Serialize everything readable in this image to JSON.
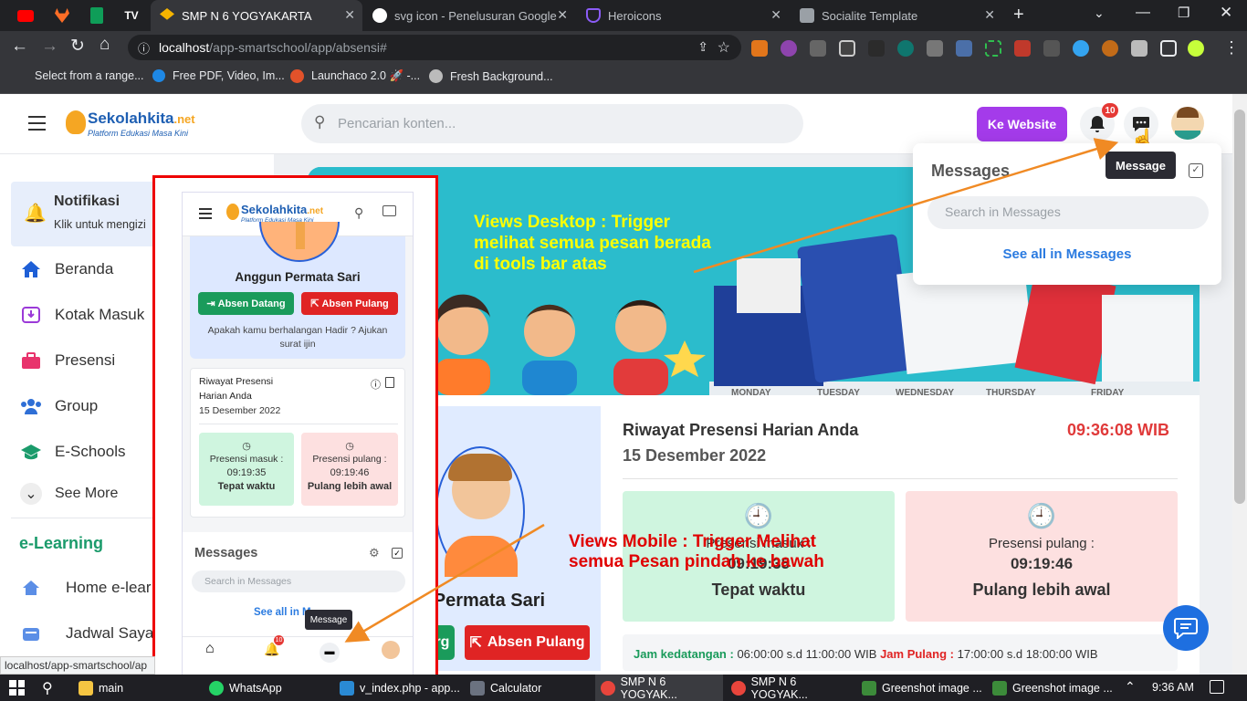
{
  "browser": {
    "tabs": [
      {
        "label": "SMP N 6 YOGYAKARTA"
      },
      {
        "label": "svg icon - Penelusuran Google"
      },
      {
        "label": "Heroicons"
      },
      {
        "label": "Socialite Template"
      }
    ],
    "url_host": "localhost",
    "url_path": "/app-smartschool/app/absensi#",
    "bookmarks": [
      "Select from a range...",
      "Free PDF, Video, Im...",
      "Launchaco 2.0 🚀 -...",
      "Fresh Background..."
    ]
  },
  "header": {
    "logo_text": "Sekolahkita",
    "logo_suffix": ".net",
    "logo_tagline": "Platform Edukasi Masa Kini",
    "search_placeholder": "Pencarian konten...",
    "website_button": "Ke Website",
    "notif_count": "10"
  },
  "sidebar": {
    "notif_title": "Notifikasi",
    "notif_sub": "Klik untuk mengizi",
    "items": [
      "Beranda",
      "Kotak Masuk",
      "Presensi",
      "Group",
      "E-Schools"
    ],
    "see_more": "See More",
    "section": "e-Learning",
    "learning_items": [
      "Home e-lear",
      "Jadwal Saya"
    ]
  },
  "messages_dropdown": {
    "title": "Messages",
    "tooltip": "Message",
    "search_placeholder": "Search in Messages",
    "see_all": "See all in Messages"
  },
  "annotations": {
    "desktop": "Views Desktop : Trigger melihat semua pesan berada di tools bar atas",
    "desktop_lines": [
      "Views Desktop : Trigger",
      "melihat semua pesan berada",
      "di tools bar atas"
    ],
    "mobile_lines": [
      "Views Mobile : Trigger Melihat",
      "semua Pesan pindah ke bawah"
    ]
  },
  "presence": {
    "title": "Riwayat Presensi Harian Anda",
    "date": "15 Desember 2022",
    "time": "09:36:08 WIB",
    "in_label": "Presensi masuk :",
    "in_time": "09:19:35",
    "in_status": "Tepat waktu",
    "out_label": "Presensi pulang :",
    "out_time": "09:19:46",
    "out_status": "Pulang lebih awal",
    "name_partial": "n Permata Sari",
    "btn_in_partial": "arg",
    "btn_out": "Absen Pulang",
    "schedule_in_label": "Jam kedatangan :",
    "schedule_in": "06:00:00 s.d 11:00:00 WIB",
    "schedule_out_label": "Jam Pulang :",
    "schedule_out": "17:00:00 s.d 18:00:00 WIB"
  },
  "mobile": {
    "name": "Anggun Permata Sari",
    "btn_in": "Absen Datang",
    "btn_out": "Absen Pulang",
    "absent_note": "Apakah kamu berhalangan Hadir ? Ajukan surat ijin",
    "history_title_1": "Riwayat Presensi",
    "history_title_2": "Harian Anda",
    "date": "15 Desember 2022",
    "in_label": "Presensi masuk :",
    "in_time": "09:19:35",
    "in_status": "Tepat waktu",
    "out_label": "Presensi pulang :",
    "out_time": "09:19:46",
    "out_status": "Pulang lebih awal",
    "messages_title": "Messages",
    "search_placeholder": "Search in Messages",
    "see_all_partial": "See all in M",
    "tooltip": "Message",
    "notif_count": "10"
  },
  "status_url": "localhost/app-smartschool/ap",
  "taskbar": {
    "items": [
      "main",
      "WhatsApp",
      "v_index.php - app...",
      "Calculator",
      "SMP N 6 YOGYAK...",
      "SMP N 6 YOGYAK...",
      "Greenshot image ...",
      "Greenshot image ..."
    ],
    "clock": "9:36 AM"
  },
  "colors": {
    "accent_purple": "#a43bea",
    "banner": "#29b8c9",
    "annotation_yellow": "#ffff00",
    "annotation_red": "#e00000",
    "arrow_orange": "#f08a24"
  }
}
